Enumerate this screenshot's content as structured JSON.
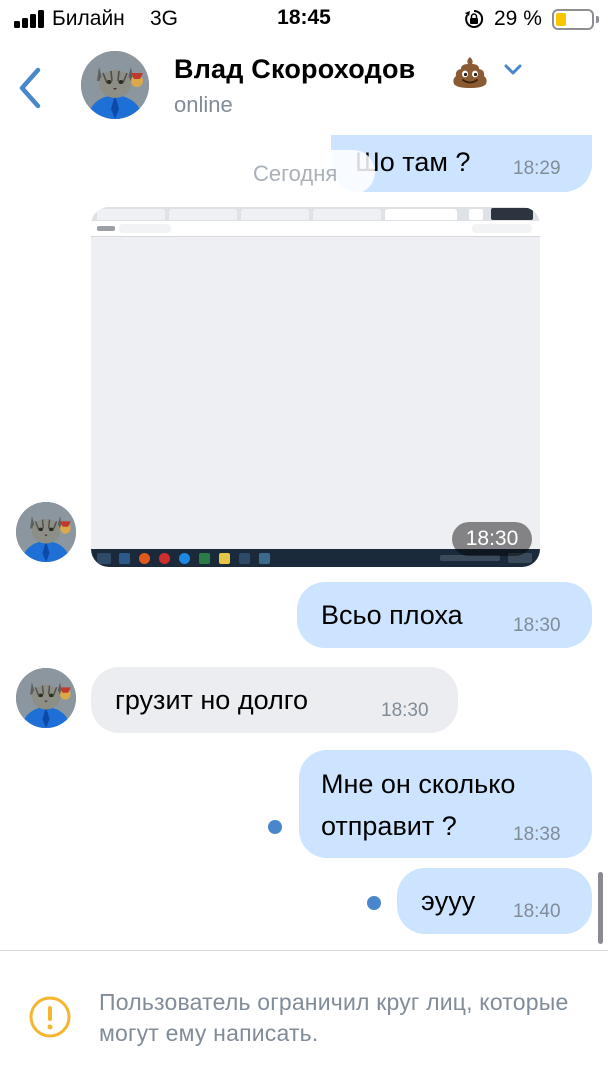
{
  "status_bar": {
    "carrier": "Билайн",
    "network": "3G",
    "time": "18:45",
    "battery_percent_label": "29 %",
    "battery_level": 0.29
  },
  "header": {
    "name": "Влад Скороходов",
    "name_emoji": "pile-of-poo-emoji",
    "status": "online"
  },
  "chat": {
    "date_separator": "Сегодня",
    "messages": [
      {
        "direction": "out",
        "text": "Шо там ?",
        "time": "18:29"
      },
      {
        "direction": "in",
        "type": "photo",
        "time": "18:30"
      },
      {
        "direction": "out",
        "text": "Всьо плоха",
        "time": "18:30"
      },
      {
        "direction": "in",
        "text": "грузит но долго",
        "time": "18:30"
      },
      {
        "direction": "out",
        "text_lines": [
          "Мне он сколько",
          "отправит ?"
        ],
        "time": "18:38",
        "unread": true
      },
      {
        "direction": "out",
        "text": "эууу",
        "time": "18:40",
        "unread": true
      }
    ]
  },
  "footer": {
    "restriction_text": "Пользователь ограничил круг лиц, которые могут ему написать."
  },
  "colors": {
    "accent": "#4986cc",
    "outgoing_bubble": "#cce4ff",
    "incoming_bubble": "#ebedf0",
    "secondary_text": "#818c99",
    "warning_icon": "#f5b52e"
  }
}
